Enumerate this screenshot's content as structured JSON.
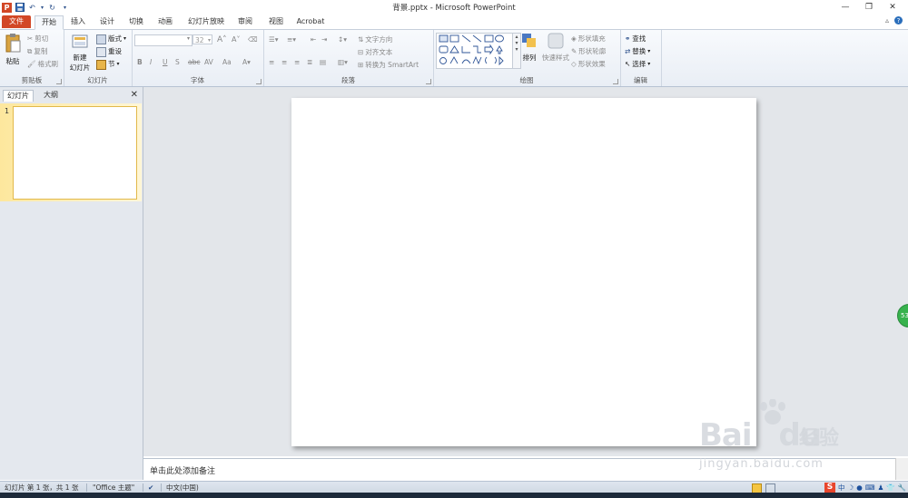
{
  "window": {
    "title": "背景.pptx - Microsoft PowerPoint"
  },
  "tabs": {
    "file": "文件",
    "home": "开始",
    "insert": "插入",
    "design": "设计",
    "transitions": "切换",
    "animations": "动画",
    "slideshow": "幻灯片放映",
    "review": "审阅",
    "view": "视图",
    "acrobat": "Acrobat"
  },
  "ribbon": {
    "clipboard": {
      "label": "剪贴板",
      "paste": "粘贴",
      "cut": "剪切",
      "copy": "复制",
      "format_painter": "格式刷"
    },
    "slides": {
      "label": "幻灯片",
      "new_slide": "新建",
      "new_slide2": "幻灯片",
      "layout": "版式",
      "reset": "重设",
      "section": "节"
    },
    "font": {
      "label": "字体",
      "size": "32"
    },
    "paragraph": {
      "label": "段落",
      "text_direction": "文字方向",
      "align_text": "对齐文本",
      "smartart": "转换为 SmartArt"
    },
    "drawing": {
      "label": "绘图",
      "arrange": "排列",
      "quick_styles": "快速样式",
      "shape_fill": "形状填充",
      "shape_outline": "形状轮廓",
      "shape_effects": "形状效果"
    },
    "editing": {
      "label": "编辑",
      "find": "查找",
      "replace": "替换",
      "select": "选择"
    }
  },
  "left_pane": {
    "tab_slides": "幻灯片",
    "tab_outline": "大纲",
    "thumb_number": "1"
  },
  "notes": {
    "placeholder": "单击此处添加备注"
  },
  "status": {
    "slide_info": "幻灯片 第 1 张，共 1 张",
    "theme": "\"Office 主题\"",
    "language": "中文(中国)"
  },
  "ime": {
    "chinese": "中"
  },
  "side_badge": {
    "text": "53"
  },
  "watermark": {
    "logo_left": "Bai",
    "logo_right": "du",
    "brand": "经验",
    "url": "jingyan.baidu.com"
  }
}
